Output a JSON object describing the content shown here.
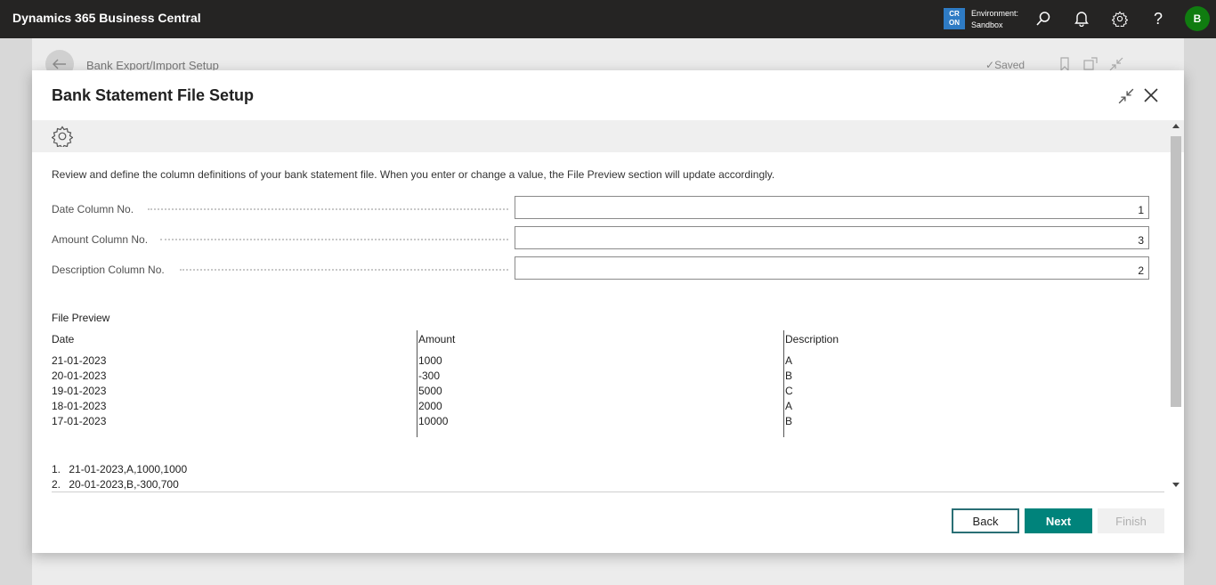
{
  "topbar": {
    "app_title": "Dynamics 365 Business Central",
    "env_badge_line1": "CR",
    "env_badge_line2": "ON",
    "env_label_line1": "Environment:",
    "env_label_line2": "Sandbox",
    "avatar_initial": "B",
    "icons": [
      "search-icon",
      "bell-icon",
      "gear-icon",
      "help-icon"
    ],
    "help_glyph": "?"
  },
  "background_page": {
    "title": "Bank Export/Import Setup",
    "saved_status": "Saved"
  },
  "dialog": {
    "title": "Bank Statement File Setup",
    "intro": "Review and define the column definitions of your bank statement file. When you enter or change a value, the File Preview section will update accordingly.",
    "fields": [
      {
        "label": "Date Column No.",
        "value": "1"
      },
      {
        "label": "Amount Column No.",
        "value": "3"
      },
      {
        "label": "Description Column No.",
        "value": "2"
      }
    ],
    "file_preview": {
      "title": "File Preview",
      "columns": [
        "Date",
        "Amount",
        "Description"
      ],
      "dates": [
        "21-01-2023",
        "20-01-2023",
        "19-01-2023",
        "18-01-2023",
        "17-01-2023"
      ],
      "amounts": [
        "1000",
        "-300",
        "5000",
        "2000",
        "10000"
      ],
      "descriptions": [
        "A",
        "B",
        "C",
        "A",
        "B"
      ]
    },
    "raw_lines": [
      {
        "num": "1.",
        "text": "21-01-2023,A,1000,1000"
      },
      {
        "num": "2.",
        "text": "20-01-2023,B,-300,700"
      }
    ],
    "buttons": {
      "back": "Back",
      "next": "Next",
      "finish": "Finish"
    }
  },
  "colors": {
    "topbar_bg": "#252423",
    "accent": "#00837b",
    "avatar_bg": "#107c10",
    "env_badge_bg": "#2e7bc4"
  }
}
